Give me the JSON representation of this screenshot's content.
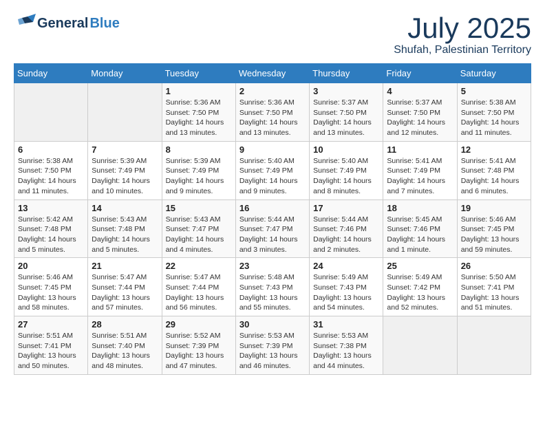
{
  "header": {
    "logo_line1": "General",
    "logo_line2": "Blue",
    "month_year": "July 2025",
    "location": "Shufah, Palestinian Territory"
  },
  "calendar": {
    "days_of_week": [
      "Sunday",
      "Monday",
      "Tuesday",
      "Wednesday",
      "Thursday",
      "Friday",
      "Saturday"
    ],
    "weeks": [
      [
        {
          "day": "",
          "info": ""
        },
        {
          "day": "",
          "info": ""
        },
        {
          "day": "1",
          "info": "Sunrise: 5:36 AM\nSunset: 7:50 PM\nDaylight: 14 hours\nand 13 minutes."
        },
        {
          "day": "2",
          "info": "Sunrise: 5:36 AM\nSunset: 7:50 PM\nDaylight: 14 hours\nand 13 minutes."
        },
        {
          "day": "3",
          "info": "Sunrise: 5:37 AM\nSunset: 7:50 PM\nDaylight: 14 hours\nand 13 minutes."
        },
        {
          "day": "4",
          "info": "Sunrise: 5:37 AM\nSunset: 7:50 PM\nDaylight: 14 hours\nand 12 minutes."
        },
        {
          "day": "5",
          "info": "Sunrise: 5:38 AM\nSunset: 7:50 PM\nDaylight: 14 hours\nand 11 minutes."
        }
      ],
      [
        {
          "day": "6",
          "info": "Sunrise: 5:38 AM\nSunset: 7:50 PM\nDaylight: 14 hours\nand 11 minutes."
        },
        {
          "day": "7",
          "info": "Sunrise: 5:39 AM\nSunset: 7:49 PM\nDaylight: 14 hours\nand 10 minutes."
        },
        {
          "day": "8",
          "info": "Sunrise: 5:39 AM\nSunset: 7:49 PM\nDaylight: 14 hours\nand 9 minutes."
        },
        {
          "day": "9",
          "info": "Sunrise: 5:40 AM\nSunset: 7:49 PM\nDaylight: 14 hours\nand 9 minutes."
        },
        {
          "day": "10",
          "info": "Sunrise: 5:40 AM\nSunset: 7:49 PM\nDaylight: 14 hours\nand 8 minutes."
        },
        {
          "day": "11",
          "info": "Sunrise: 5:41 AM\nSunset: 7:49 PM\nDaylight: 14 hours\nand 7 minutes."
        },
        {
          "day": "12",
          "info": "Sunrise: 5:41 AM\nSunset: 7:48 PM\nDaylight: 14 hours\nand 6 minutes."
        }
      ],
      [
        {
          "day": "13",
          "info": "Sunrise: 5:42 AM\nSunset: 7:48 PM\nDaylight: 14 hours\nand 5 minutes."
        },
        {
          "day": "14",
          "info": "Sunrise: 5:43 AM\nSunset: 7:48 PM\nDaylight: 14 hours\nand 5 minutes."
        },
        {
          "day": "15",
          "info": "Sunrise: 5:43 AM\nSunset: 7:47 PM\nDaylight: 14 hours\nand 4 minutes."
        },
        {
          "day": "16",
          "info": "Sunrise: 5:44 AM\nSunset: 7:47 PM\nDaylight: 14 hours\nand 3 minutes."
        },
        {
          "day": "17",
          "info": "Sunrise: 5:44 AM\nSunset: 7:46 PM\nDaylight: 14 hours\nand 2 minutes."
        },
        {
          "day": "18",
          "info": "Sunrise: 5:45 AM\nSunset: 7:46 PM\nDaylight: 14 hours\nand 1 minute."
        },
        {
          "day": "19",
          "info": "Sunrise: 5:46 AM\nSunset: 7:45 PM\nDaylight: 13 hours\nand 59 minutes."
        }
      ],
      [
        {
          "day": "20",
          "info": "Sunrise: 5:46 AM\nSunset: 7:45 PM\nDaylight: 13 hours\nand 58 minutes."
        },
        {
          "day": "21",
          "info": "Sunrise: 5:47 AM\nSunset: 7:44 PM\nDaylight: 13 hours\nand 57 minutes."
        },
        {
          "day": "22",
          "info": "Sunrise: 5:47 AM\nSunset: 7:44 PM\nDaylight: 13 hours\nand 56 minutes."
        },
        {
          "day": "23",
          "info": "Sunrise: 5:48 AM\nSunset: 7:43 PM\nDaylight: 13 hours\nand 55 minutes."
        },
        {
          "day": "24",
          "info": "Sunrise: 5:49 AM\nSunset: 7:43 PM\nDaylight: 13 hours\nand 54 minutes."
        },
        {
          "day": "25",
          "info": "Sunrise: 5:49 AM\nSunset: 7:42 PM\nDaylight: 13 hours\nand 52 minutes."
        },
        {
          "day": "26",
          "info": "Sunrise: 5:50 AM\nSunset: 7:41 PM\nDaylight: 13 hours\nand 51 minutes."
        }
      ],
      [
        {
          "day": "27",
          "info": "Sunrise: 5:51 AM\nSunset: 7:41 PM\nDaylight: 13 hours\nand 50 minutes."
        },
        {
          "day": "28",
          "info": "Sunrise: 5:51 AM\nSunset: 7:40 PM\nDaylight: 13 hours\nand 48 minutes."
        },
        {
          "day": "29",
          "info": "Sunrise: 5:52 AM\nSunset: 7:39 PM\nDaylight: 13 hours\nand 47 minutes."
        },
        {
          "day": "30",
          "info": "Sunrise: 5:53 AM\nSunset: 7:39 PM\nDaylight: 13 hours\nand 46 minutes."
        },
        {
          "day": "31",
          "info": "Sunrise: 5:53 AM\nSunset: 7:38 PM\nDaylight: 13 hours\nand 44 minutes."
        },
        {
          "day": "",
          "info": ""
        },
        {
          "day": "",
          "info": ""
        }
      ]
    ]
  }
}
